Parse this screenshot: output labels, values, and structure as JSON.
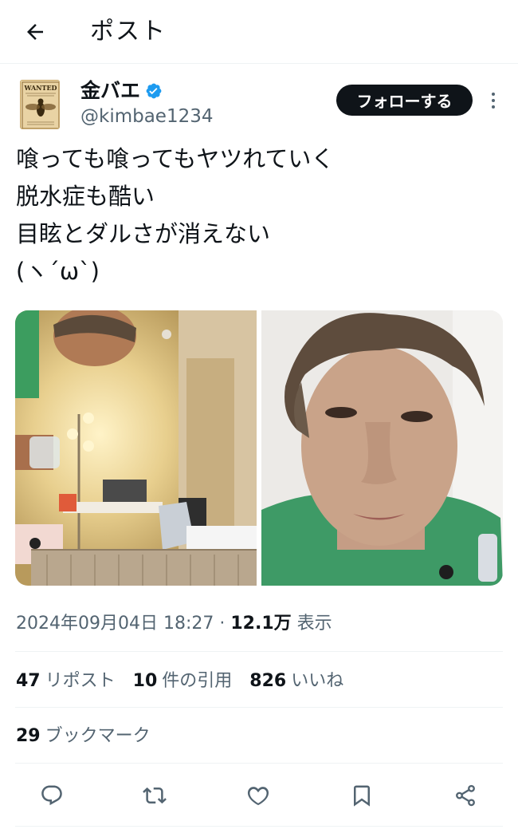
{
  "header": {
    "title": "ポスト",
    "back_icon": "arrow-left-icon"
  },
  "author": {
    "display_name": "金バエ",
    "handle": "@kimbae1234",
    "verified": true,
    "verified_color": "#1d9bf0",
    "avatar_text": "WANTED",
    "follow_label": "フォローする"
  },
  "post": {
    "lines": [
      "喰っても喰ってもヤツれていく",
      "脱水症も酷い",
      "目眩とダルさが消えない",
      "(ヽ´ω`)"
    ],
    "images": [
      {
        "description": "selfie-room-lamp"
      },
      {
        "description": "selfie-face-closeup"
      }
    ]
  },
  "meta": {
    "timestamp": "2024年09月04日 18:27",
    "separator": " · ",
    "views_count": "12.1万",
    "views_label": " 表示"
  },
  "stats": {
    "reposts": {
      "count": "47",
      "label": "リポスト"
    },
    "quotes": {
      "count": "10",
      "label": "件の引用"
    },
    "likes": {
      "count": "826",
      "label": "いいね"
    },
    "bookmarks": {
      "count": "29",
      "label": "ブックマーク"
    }
  },
  "actions": [
    "reply-icon",
    "repost-icon",
    "like-icon",
    "bookmark-icon",
    "share-icon"
  ],
  "colors": {
    "text_primary": "#0f1419",
    "text_secondary": "#536471",
    "border": "#eff3f4",
    "follow_button": "#0f1419"
  }
}
